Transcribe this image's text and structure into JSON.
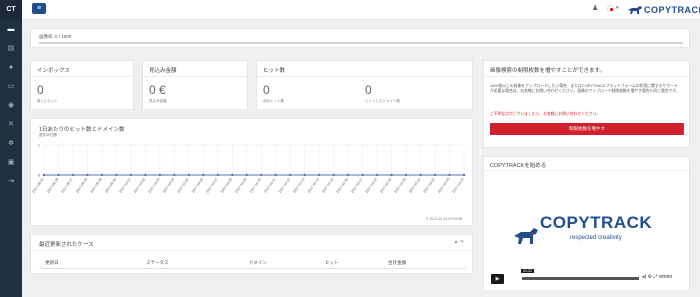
{
  "sidebar": {
    "brand": "CT",
    "items": [
      {
        "icon": "dashboard-icon",
        "glyph": "▬"
      },
      {
        "icon": "document-icon",
        "glyph": "▤"
      },
      {
        "icon": "user-icon",
        "glyph": "●"
      },
      {
        "icon": "inbox-icon",
        "glyph": "▭"
      },
      {
        "icon": "eye-icon",
        "glyph": "◉"
      },
      {
        "icon": "tools-icon",
        "glyph": "✕"
      },
      {
        "icon": "gear-icon",
        "glyph": "✻"
      },
      {
        "icon": "box-icon",
        "glyph": "▣"
      },
      {
        "icon": "logout-icon",
        "glyph": "⇥"
      }
    ]
  },
  "topbar": {
    "menu_glyph": "≡",
    "user_glyph": "♟",
    "caret": "▾",
    "logo_text": "COPYTRACK"
  },
  "quota": {
    "label": "画像枠: 0 / 1000",
    "fill": 0
  },
  "stats": {
    "inbox": {
      "title": "インボックス",
      "value": "0",
      "sublabel": "新しいヒット"
    },
    "revenue": {
      "title": "見込み金額",
      "value": "0 €",
      "sublabel": "見込み金額"
    },
    "hits": {
      "title": "ヒット数",
      "value1": "0",
      "sub1": "合計ヒット数",
      "value2": "0",
      "sub2": "ヒットしたドメイン数"
    }
  },
  "chart": {
    "title": "1日あたりのヒット数とドメイン数",
    "subtitle": "過去30日間",
    "footnote": "© 2017-10-24 07:53:06"
  },
  "chart_data": {
    "type": "line",
    "title": "1日あたりのヒット数とドメイン数",
    "ylim": [
      0,
      1
    ],
    "yticks": [
      "1",
      "0"
    ],
    "grid": true,
    "x": [
      "2017-09-25",
      "2017-09-26",
      "2017-09-27",
      "2017-09-28",
      "2017-09-29",
      "2017-09-30",
      "2017-10-01",
      "2017-10-02",
      "2017-10-03",
      "2017-10-04",
      "2017-10-05",
      "2017-10-06",
      "2017-10-07",
      "2017-10-08",
      "2017-10-09",
      "2017-10-10",
      "2017-10-11",
      "2017-10-12",
      "2017-10-13",
      "2017-10-14",
      "2017-10-15",
      "2017-10-16",
      "2017-10-17",
      "2017-10-18",
      "2017-10-19",
      "2017-10-20",
      "2017-10-21",
      "2017-10-22",
      "2017-10-23",
      "2017-10-24"
    ],
    "series": [
      {
        "values": [
          0,
          0,
          0,
          0,
          0,
          0,
          0,
          0,
          0,
          0,
          0,
          0,
          0,
          0,
          0,
          0,
          0,
          0,
          0,
          0,
          0,
          0,
          0,
          0,
          0,
          0,
          0,
          0,
          0,
          0
        ],
        "color": "#5b6fa8"
      }
    ]
  },
  "recent": {
    "title": "最近更新されたケース",
    "controls": "▲ ✕",
    "columns": [
      "更新日",
      "ステータス",
      "ドメイン",
      "ヒット",
      "合計金額"
    ]
  },
  "promo": {
    "title": "画像検索の制限枚数を増やすことができます。",
    "text": "1000枚以上の画像をアップロードしたい場合、またはCOPYTRACKプラットフォームの利用に関するサポートが必要な場合は、お気軽にお問い合わせください。画像のアップロード制限枚数を増やす場合も同じ場合です。",
    "link": "ご不明な点がございましたら、お気軽にお問い合わせください。",
    "button": "制限枚数を増やす"
  },
  "video": {
    "title": "COPYTRACKを始める",
    "logo_text": "COPYTRACK",
    "tagline": "respected creativity",
    "time": "01:33",
    "play": "▶",
    "controls": "◂) ⚙ ⤢ vimeo"
  }
}
